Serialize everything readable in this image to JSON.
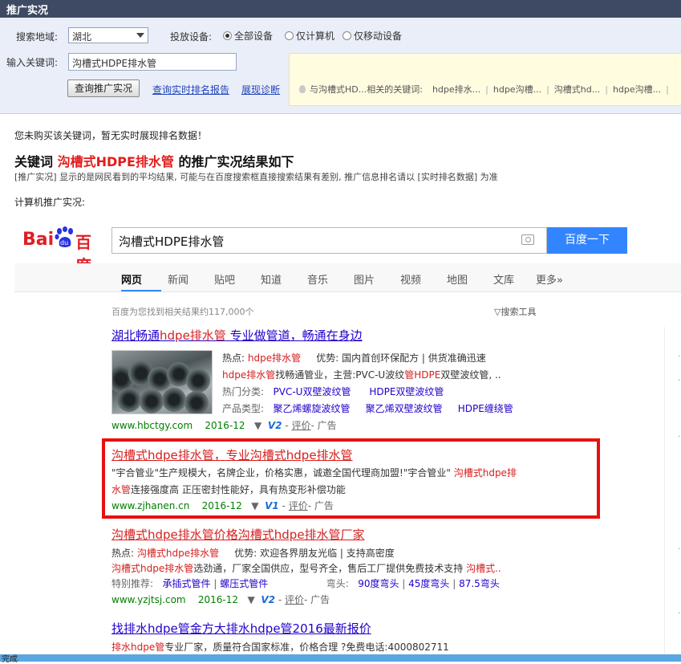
{
  "window": {
    "title": "推广实况"
  },
  "form": {
    "region_label": "搜索地域:",
    "region_value": "湖北",
    "device_label": "投放设备:",
    "devices": [
      "全部设备",
      "仅计算机",
      "仅移动设备"
    ],
    "keyword_label": "输入关键词:",
    "keyword_value": "沟槽式HDPE排水管",
    "query_button": "查询推广实况",
    "link_realtime": "查询实时排名报告",
    "link_diagnose": "展现诊断"
  },
  "tips": {
    "prefix": "与沟槽式HD...相关的关键词:",
    "tags": [
      "hdpe排水...",
      "hdpe沟槽...",
      "沟槽式hd...",
      "hdpe沟槽..."
    ]
  },
  "status": {
    "notice": "您未购买该关键词，暂无实时展现排名数据！",
    "title_prefix": "关键词",
    "title_keyword": "沟槽式HDPE排水管",
    "title_suffix": "的推广实况结果如下",
    "description": "[推广实况] 显示的是网民看到的平均结果, 可能与在百度搜索框直接搜索结果有差别, 推广信息排名请以 [实时排名数据] 为准",
    "pc_label": "计算机推广实况:"
  },
  "baidu": {
    "logo_left": "Bai",
    "logo_paw": "du",
    "logo_right": "百度",
    "query": "沟槽式HDPE排水管",
    "search_button": "百度一下",
    "tabs": [
      "网页",
      "新闻",
      "贴吧",
      "知道",
      "音乐",
      "图片",
      "视频",
      "地图",
      "文库",
      "更多»"
    ],
    "result_count": "百度为您找到相关结果约117,000个",
    "tools": "搜索工具"
  },
  "results": {
    "r1": {
      "title_a": "湖北畅通",
      "title_em": "hdpe排水管",
      "title_b": " 专业做管道，畅通在身边",
      "hot_label": "热点:",
      "hot_val": "hdpe排水管",
      "adv_label": "优势:",
      "adv_val": "国内首创环保配方 | 供货准确迅速",
      "line2_em": "hdpe排水管",
      "line2_b": "找畅通管业，主营:PVC-U波纹",
      "line2_em2": "管HDPE",
      "line2_c": "双壁波纹管, ..",
      "cat_label": "热门分类:",
      "cat1": "PVC-U双壁波纹管",
      "cat2": "HDPE双壁波纹管",
      "prod_label": "产品类型:",
      "prod1": "聚乙烯螺旋波纹管",
      "prod2": "聚乙烯双壁波纹管",
      "prod3": "HDPE缠绕管",
      "url": "www.hbctgy.com",
      "date": "2016-12",
      "v": "V2",
      "eval": "评价",
      "ad": "- 广告"
    },
    "r2": {
      "title": "沟槽式hdpe排水管，专业沟槽式hdpe排水管",
      "line1_a": "\"宇合管业\"生产规模大，名牌企业，价格实惠，诚邀全国代理商加盟!\"宇合管业\" ",
      "line1_em": "沟槽式hdpe排",
      "line2_em": "水管",
      "line2_b": "连接强度高 正压密封性能好，具有热变形补偿功能",
      "url": "www.zjhanen.cn",
      "date": "2016-12",
      "v": "V1",
      "eval": "评价",
      "ad": "- 广告"
    },
    "r3": {
      "title": "沟槽式hdpe排水管价格沟槽式hdpe排水管厂家",
      "hot_label": "热点:",
      "hot_val": "沟槽式hdpe排水管",
      "adv_label": "优势:",
      "adv_val": "欢迎各界朋友光临 | 支持高密度",
      "line2_em": "沟槽式hdpe排水管",
      "line2_b": "选劲通，厂家全国供应，型号齐全，售后工厂提供免费技术支持",
      "line2_em2": " 沟槽式..",
      "rec_label": "特别推荐:",
      "rec1": "承插式管件",
      "rec2": "螺压式管件",
      "elbow_label": "弯头:",
      "elbow1": "90度弯头",
      "elbow2": "45度弯头",
      "elbow3": "87.5弯头",
      "url": "www.yzjtsj.com",
      "date": "2016-12",
      "v": "V2",
      "eval": "评价",
      "ad": "- 广告"
    },
    "r4": {
      "title": "找排水hdpe管金方大排水hdpe管2016最新报价",
      "line1_em": "排水hdpe管",
      "line1_b": "专业厂家，质量符合国家标准，价格合理 ?免费电话:4000802711"
    }
  },
  "statusbar": {
    "text": "完成"
  },
  "colors": {
    "accent": "#3385ff",
    "highlight": "#e81010",
    "link": "#2200cc",
    "url": "#008000"
  }
}
